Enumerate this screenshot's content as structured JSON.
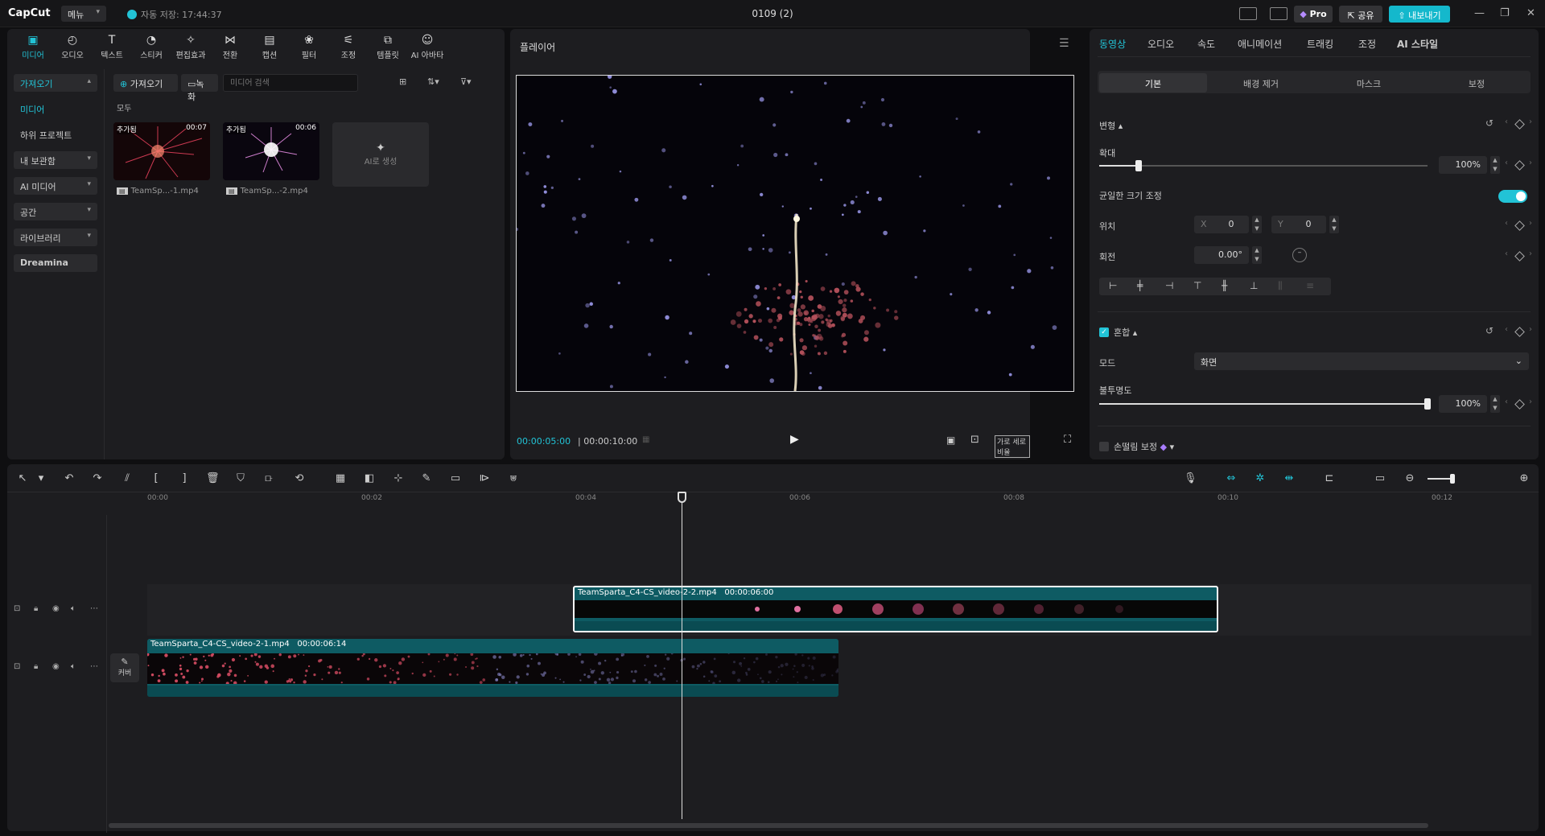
{
  "titlebar": {
    "app_name": "CapCut",
    "menu_label": "메뉴",
    "autosave_text": "자동 저장: 17:44:37",
    "doc_title": "0109 (2)",
    "pro_label": "Pro",
    "share_label": "공유",
    "export_label": "내보내기"
  },
  "toolbar": {
    "tools": [
      {
        "label": "미디어",
        "icon": "media-icon"
      },
      {
        "label": "오디오",
        "icon": "audio-icon"
      },
      {
        "label": "텍스트",
        "icon": "text-icon"
      },
      {
        "label": "스티커",
        "icon": "sticker-icon"
      },
      {
        "label": "편집효과",
        "icon": "effects-icon"
      },
      {
        "label": "전환",
        "icon": "transition-icon"
      },
      {
        "label": "캡션",
        "icon": "caption-icon"
      },
      {
        "label": "필터",
        "icon": "filter-icon"
      },
      {
        "label": "조정",
        "icon": "adjust-icon"
      },
      {
        "label": "템플릿",
        "icon": "template-icon"
      },
      {
        "label": "AI 아바타",
        "icon": "ai-avatar-icon"
      }
    ]
  },
  "sidebar": {
    "items": [
      {
        "label": "가져오기"
      },
      {
        "label": "미디어"
      },
      {
        "label": "하위 프로젝트"
      },
      {
        "label": "내 보관함"
      },
      {
        "label": "AI 미디어"
      },
      {
        "label": "공간"
      },
      {
        "label": "라이브러리"
      },
      {
        "label": "Dreamina"
      }
    ]
  },
  "media": {
    "import_label": "가져오기",
    "record_label": "녹화",
    "search_placeholder": "미디어 검색",
    "filter_all": "모두",
    "ai_generate_label": "AI로 생성",
    "items": [
      {
        "tag": "추가됨",
        "duration": "00:07",
        "filename": "TeamSp...-1.mp4"
      },
      {
        "tag": "추가됨",
        "duration": "00:06",
        "filename": "TeamSp...-2.mp4"
      }
    ]
  },
  "player": {
    "title": "플레이어",
    "current_time": "00:00:05:00",
    "total_time": "00:00:10:00",
    "ratio_label": "가로 세로 비율"
  },
  "properties": {
    "tabs": [
      "동영상",
      "오디오",
      "속도",
      "애니메이션",
      "트래킹",
      "조정",
      "AI 스타일"
    ],
    "subtabs": [
      "기본",
      "배경 제거",
      "마스크",
      "보정"
    ],
    "transform_label": "변형",
    "scale_label": "확대",
    "scale_value": "100%",
    "scale_level": 0.12,
    "uniform_scale_label": "균일한 크기 조정",
    "position_label": "위치",
    "x_label": "X",
    "x_value": "0",
    "y_label": "Y",
    "y_value": "0",
    "rotation_label": "회전",
    "rotation_value": "0.00°",
    "blend_label": "혼합",
    "mode_label": "모드",
    "mode_value": "화면",
    "opacity_label": "불투명도",
    "opacity_value": "100%",
    "opacity_level": 1.0,
    "stabilize_label": "손떨림 보정"
  },
  "timeline": {
    "ruler": [
      "00:00",
      "00:02",
      "00:04",
      "00:06",
      "00:08",
      "00:10",
      "00:12"
    ],
    "cover_label": "커버",
    "clips": [
      {
        "name": "TeamSparta_C4-CS_video-2-2.mp4",
        "duration": "00:00:06:00"
      },
      {
        "name": "TeamSparta_C4-CS_video-2-1.mp4",
        "duration": "00:00:06:14"
      }
    ]
  },
  "colors": {
    "accent": "#22c3d6",
    "clip_teal": "#0e5b63"
  }
}
